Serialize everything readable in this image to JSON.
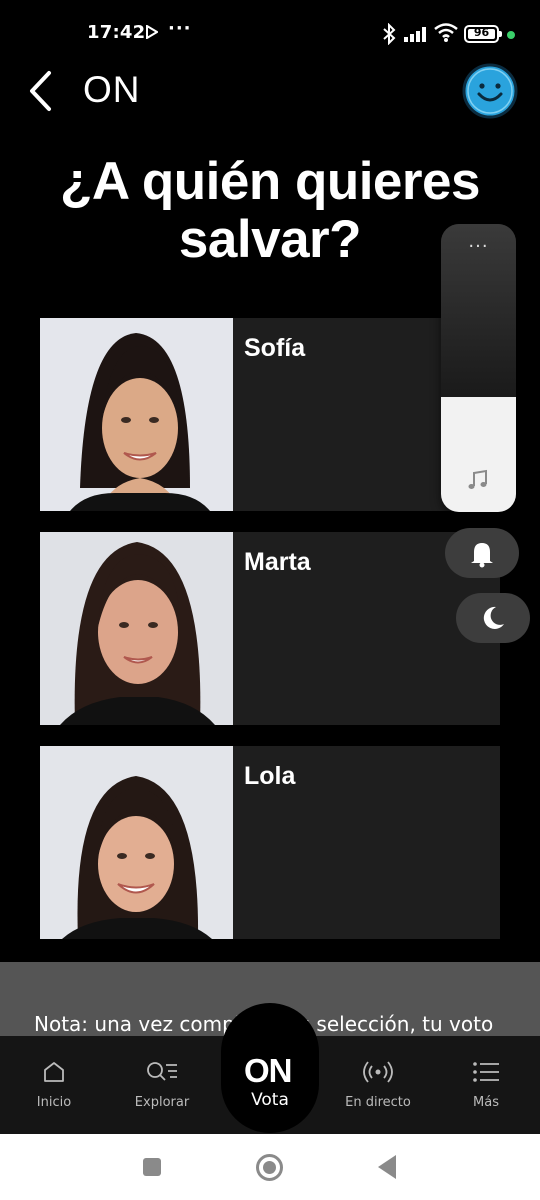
{
  "status_bar": {
    "time": "17:42",
    "more": "···",
    "battery": "96"
  },
  "header": {
    "title": "ON"
  },
  "headline": {
    "line1": "¿A quién quieres",
    "line2": "salvar?"
  },
  "contestants": [
    {
      "name": "Sofía"
    },
    {
      "name": "Marta"
    },
    {
      "name": "Lola"
    }
  ],
  "volume_overlay": {
    "level_percent": 40,
    "more": "···"
  },
  "note": {
    "text": "Nota: una vez completes tu selección, tu voto"
  },
  "tabs": {
    "inicio": "Inicio",
    "explorar": "Explorar",
    "vota_logo": "ON",
    "vota": "Vota",
    "en_directo": "En directo",
    "mas": "Más"
  },
  "icons": {
    "back": "chevron-left-icon",
    "avatar": "smiley-face-icon",
    "music": "music-note-icon",
    "ring": "bell-icon",
    "dnd": "moon-icon"
  },
  "colors": {
    "accent": "#2aa3dd",
    "card_bg": "#1e1e1e",
    "note_bg": "#555555"
  }
}
